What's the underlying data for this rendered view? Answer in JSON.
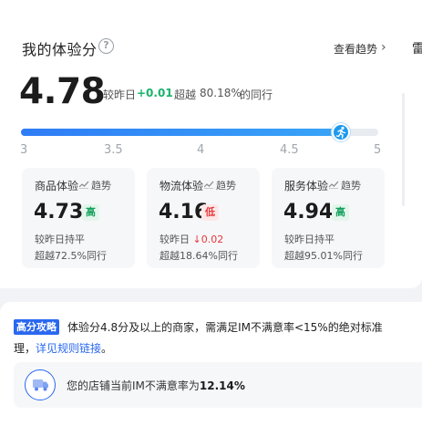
{
  "header": {
    "title": "我的体验分",
    "trend_link": "查看趋势",
    "edge_text": "雷"
  },
  "score": {
    "value": "4.78",
    "compare_label": "较昨日",
    "compare_value": "+0.01",
    "beat_label": "超越",
    "beat_value": "80.18%",
    "beat_suffix": "的同行",
    "progress_fraction": 0.89
  },
  "scale_ticks": [
    "3",
    "3.5",
    "4",
    "4.5",
    "5"
  ],
  "sub_scores": [
    {
      "name": "商品体验",
      "trend": "趋势",
      "score": "4.73",
      "badge": "高",
      "line1": "较昨日持平",
      "line2": "超越72.5%同行"
    },
    {
      "name": "物流体验",
      "trend": "趋势",
      "score": "4.16",
      "badge": "低",
      "line1_prefix": "较昨日",
      "line1_delta": "0.02",
      "line2": "超越18.64%同行"
    },
    {
      "name": "服务体验",
      "trend": "趋势",
      "score": "4.94",
      "badge": "高",
      "line1": "较昨日持平",
      "line2": "超越95.01%同行"
    }
  ],
  "tip": {
    "tag": "高分攻略",
    "line1": "体验分4.8分及以上的商家，需满足IM不满意率<15%的绝对标准",
    "line2_prefix": "理，",
    "line2_link": "详见规则链接",
    "line2_suffix": "。"
  },
  "im": {
    "text_prefix": "您的店铺当前IM不满意率为",
    "rate": "12.14%"
  },
  "colors": {
    "accent": "#2a68f0",
    "up": "#19b36b",
    "down": "#e5383b"
  }
}
